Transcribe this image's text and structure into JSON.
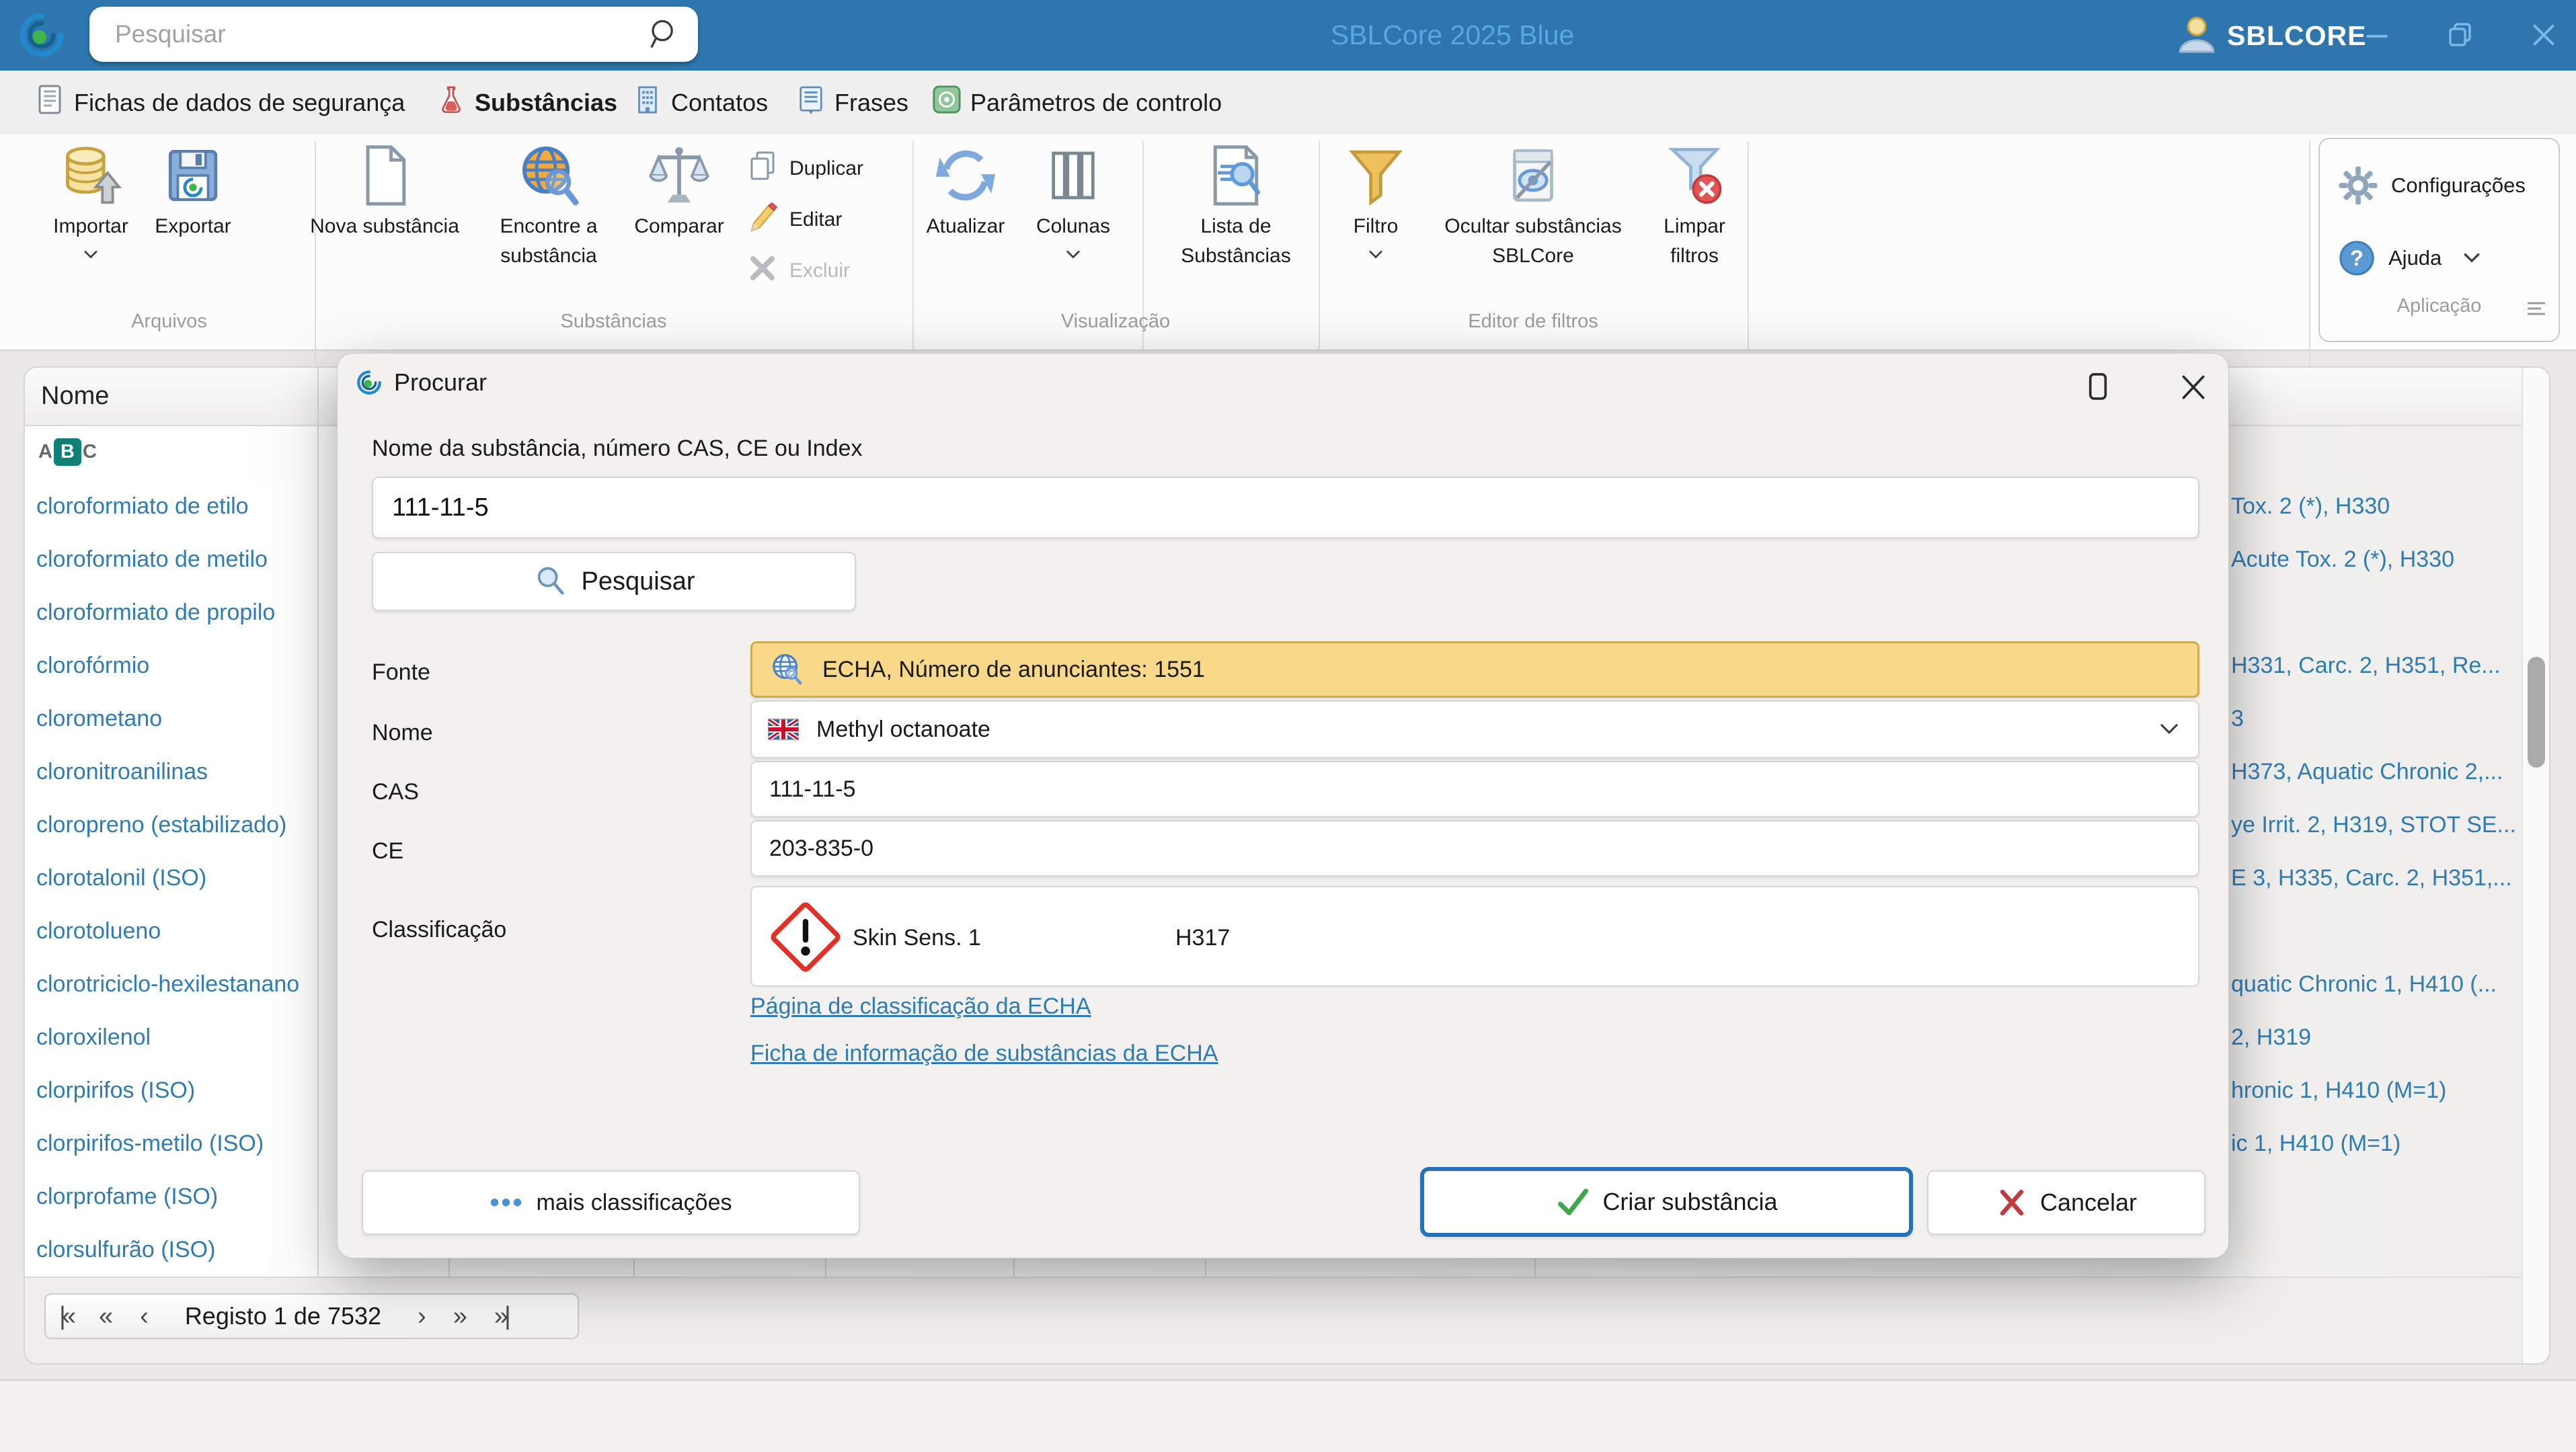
{
  "colors": {
    "titlebar": "#2E76AD",
    "accent": "#2D76AD",
    "link": "#2F7CB5",
    "fonte_bg": "#F8D98A",
    "fonte_border": "#D2A94E"
  },
  "titlebar": {
    "search_placeholder": "Pesquisar",
    "app_title": "SBLCore 2025 Blue",
    "user_name": "SBLCORE"
  },
  "tabs": {
    "sds": "Fichas de dados de segurança",
    "substancias": "Substâncias",
    "contatos": "Contatos",
    "frases": "Frases",
    "parametros": "Parâmetros de controlo"
  },
  "ribbon": {
    "groups": {
      "arquivos": "Arquivos",
      "substancias": "Substâncias",
      "visualizacao": "Visualização",
      "filtros": "Editor de filtros",
      "aplicacao": "Aplicação"
    },
    "buttons": {
      "importar": "Importar",
      "exportar": "Exportar",
      "nova": "Nova substância",
      "encontre1": "Encontre a",
      "encontre2": "substância",
      "comparar": "Comparar",
      "duplicar": "Duplicar",
      "editar": "Editar",
      "excluir": "Excluir",
      "atualizar": "Atualizar",
      "colunas": "Colunas",
      "lista1": "Lista de",
      "lista2": "Substâncias",
      "filtro": "Filtro",
      "ocultar1": "Ocultar substâncias",
      "ocultar2": "SBLCore",
      "limpar1": "Limpar",
      "limpar2": "filtros",
      "configuracoes": "Configurações",
      "ajuda": "Ajuda"
    }
  },
  "table": {
    "header": "Nome",
    "rows": [
      {
        "name": "cloroformiato de etilo",
        "classification": "Tox. 2 (*), H330"
      },
      {
        "name": "cloroformiato de metilo",
        "classification": "Acute Tox. 2 (*), H330"
      },
      {
        "name": "cloroformiato de propilo",
        "classification": ""
      },
      {
        "name": "clorofórmio",
        "classification": "H331, Carc. 2, H351, Re..."
      },
      {
        "name": "clorometano",
        "classification": "3"
      },
      {
        "name": "cloronitroanilinas",
        "classification": "H373, Aquatic Chronic 2,..."
      },
      {
        "name": "cloropreno (estabilizado)",
        "classification": "ye Irrit. 2, H319, STOT SE..."
      },
      {
        "name": "clorotalonil (ISO)",
        "classification": "E 3, H335, Carc. 2, H351,..."
      },
      {
        "name": "clorotolueno",
        "classification": ""
      },
      {
        "name": "clorotriciclo-hexilestanano",
        "classification": "quatic Chronic 1, H410 (..."
      },
      {
        "name": "cloroxilenol",
        "classification": "2, H319"
      },
      {
        "name": "clorpirifos (ISO)",
        "classification": "hronic 1, H410 (M=1)"
      },
      {
        "name": "clorpirifos-metilo (ISO)",
        "classification": "ic 1, H410 (M=1)"
      },
      {
        "name": "clorprofame (ISO)",
        "classification": ""
      },
      {
        "name": "clorsulfurão (ISO)",
        "classification": ""
      }
    ]
  },
  "pagination": {
    "first": "|«",
    "fast_prev": "«",
    "prev": "‹",
    "label": "Registo 1 de 7532",
    "next": "›",
    "fast_next": "»",
    "last": "»|"
  },
  "dialog": {
    "title": "Procurar",
    "search_label": "Nome da substância, número CAS, CE ou Index",
    "query": "111-11-5",
    "search_button": "Pesquisar",
    "fonte_label": "Fonte",
    "fonte_value": "ECHA, Número de anunciantes: 1551",
    "nome_label": "Nome",
    "nome_value": "Methyl octanoate",
    "cas_label": "CAS",
    "cas_value": "111-11-5",
    "ce_label": "CE",
    "ce_value": "203-835-0",
    "class_label": "Classificação",
    "class_name": "Skin Sens. 1",
    "class_code": "H317",
    "link_class_page": "Página de classificação da ECHA",
    "link_infocard": "Ficha de informação de substâncias da ECHA",
    "more_dots": "•••",
    "more_button": "mais classificações",
    "create_button": "Criar substância",
    "cancel_button": "Cancelar"
  }
}
